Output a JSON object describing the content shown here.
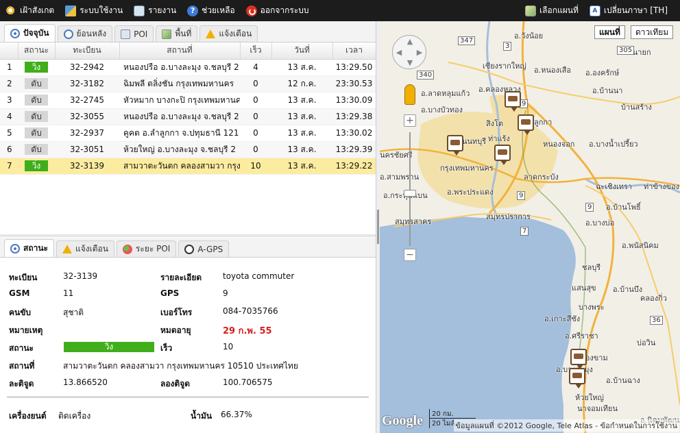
{
  "topbar": {
    "left": [
      {
        "label": "เฝ้าสังเกต",
        "icon": "search-icon"
      },
      {
        "label": "ระบบใช้งาน",
        "icon": "system-icon"
      },
      {
        "label": "รายงาน",
        "icon": "report-icon"
      },
      {
        "label": "ช่วยเหลือ",
        "icon": "help-icon"
      },
      {
        "label": "ออกจากระบบ",
        "icon": "power-icon"
      }
    ],
    "right": [
      {
        "label": "เลือกแผนที่",
        "icon": "map-icon"
      },
      {
        "label": "เปลี่ยนภาษา [TH]",
        "icon": "language-icon"
      }
    ]
  },
  "tabs_top": [
    {
      "label": "ปัจจุบัน",
      "icon": "radar-icon",
      "active": true
    },
    {
      "label": "ย้อนหลัง",
      "icon": "clock-icon"
    },
    {
      "label": "POI",
      "icon": "poi-icon"
    },
    {
      "label": "พื้นที่",
      "icon": "area-icon"
    },
    {
      "label": "แจ้งเตือน",
      "icon": "warning-icon"
    }
  ],
  "table": {
    "headers": [
      "",
      "สถานะ",
      "ทะเบียน",
      "สถานที่",
      "เร็ว",
      "วันที่",
      "เวลา"
    ],
    "rows": [
      {
        "no": "1",
        "status": "วิ่ง",
        "status_color": "#3fae1a",
        "plate": "32-2942",
        "place": "หนองปรือ อ.บางละมุง จ.ชลบุรี 2",
        "speed": "4",
        "date": "13 ส.ค.",
        "time": "13:29.50"
      },
      {
        "no": "2",
        "status": "ดับ",
        "status_color": "#d6d6d6",
        "plate": "32-3182",
        "place": "ฉิมพลี ตลิ่งชัน กรุงเทพมหานคร",
        "speed": "0",
        "date": "12 ก.ค.",
        "time": "23:30.53"
      },
      {
        "no": "3",
        "status": "ดับ",
        "status_color": "#d6d6d6",
        "plate": "32-2745",
        "place": "หัวหมาก บางกะปิ กรุงเทพมหานค",
        "speed": "0",
        "date": "13 ส.ค.",
        "time": "13:30.09"
      },
      {
        "no": "4",
        "status": "ดับ",
        "status_color": "#d6d6d6",
        "plate": "32-3055",
        "place": "หนองปรือ อ.บางละมุง จ.ชลบุรี 2",
        "speed": "0",
        "date": "13 ส.ค.",
        "time": "13:29.38"
      },
      {
        "no": "5",
        "status": "ดับ",
        "status_color": "#d6d6d6",
        "plate": "32-2937",
        "place": "คูคต อ.ลำลูกกา จ.ปทุมธานี 121",
        "speed": "0",
        "date": "13 ส.ค.",
        "time": "13:30.02"
      },
      {
        "no": "6",
        "status": "ดับ",
        "status_color": "#d6d6d6",
        "plate": "32-3051",
        "place": "ห้วยใหญ่ อ.บางละมุง จ.ชลบุรี 2",
        "speed": "0",
        "date": "13 ส.ค.",
        "time": "13:29.39"
      },
      {
        "no": "7",
        "status": "วิ่ง",
        "status_color": "#3fae1a",
        "plate": "32-3139",
        "place": "สามวาตะวันตก คลองสามวา กรุง",
        "speed": "10",
        "date": "13 ส.ค.",
        "time": "13:29.22",
        "selected": true
      }
    ]
  },
  "tabs_bottom": [
    {
      "label": "สถานะ",
      "icon": "status-icon",
      "active": true
    },
    {
      "label": "แจ้งเตือน",
      "icon": "warning-icon"
    },
    {
      "label": "ระยะ POI",
      "icon": "poi-distance-icon"
    },
    {
      "label": "A-GPS",
      "icon": "agps-icon"
    }
  ],
  "detail": {
    "plate_label": "ทะเบียน",
    "plate": "32-3139",
    "desc_label": "รายละเอียด",
    "desc": "toyota commuter",
    "gsm_label": "GSM",
    "gsm": "11",
    "gps_label": "GPS",
    "gps": "9",
    "driver_label": "คนขับ",
    "driver": "สุชาติ",
    "phone_label": "เบอร์โทร",
    "phone": "084-7035766",
    "note_label": "หมายเหตุ",
    "note": "",
    "expire_label": "หมดอายุ",
    "expire": "29 ก.พ. 55",
    "status_label": "สถานะ",
    "status": "วิ่ง",
    "speed_label": "เร็ว",
    "speed": "10",
    "place_label": "สถานที่",
    "place": "สามวาตะวันตก คลองสามวา กรุงเทพมหานคร 10510 ประเทศไทย",
    "lat_label": "ละติจูด",
    "lat": "13.866520",
    "lng_label": "ลองติจูด",
    "lng": "100.706575",
    "engine_label": "เครื่องยนต์",
    "engine": "ติดเครื่อง",
    "fuel_label": "น้ำมัน",
    "fuel": "66.37%"
  },
  "map": {
    "type_map": "แผนที่",
    "type_satellite": "ดาวเทียม",
    "labels": [
      {
        "t": "อ.วังน้อย"
      },
      {
        "t": "เชียงรากใหญ่"
      },
      {
        "t": "อ.หนองเสือ"
      },
      {
        "t": "อ.องครักษ์"
      },
      {
        "t": "อ.ลาดหลุมแก้ว"
      },
      {
        "t": "อ.คลองหลวง"
      },
      {
        "t": "อ.บ้านนา"
      },
      {
        "t": "อ.บางบัวทอง"
      },
      {
        "t": "บ้านสร้าง"
      },
      {
        "t": "สิงโต"
      },
      {
        "t": "อ.ลำลูกกา"
      },
      {
        "t": "ท่าแร้ง"
      },
      {
        "t": "หนองจอก"
      },
      {
        "t": "อ.บางน้ำเปรี้ยว"
      },
      {
        "t": "นนทบุรี"
      },
      {
        "t": "นครชัยศรี"
      },
      {
        "t": "อ.สามพราน"
      },
      {
        "t": "กรุงเทพมหานคร"
      },
      {
        "t": "ลาดกระบัง"
      },
      {
        "t": "ฉะเชิงเทรา"
      },
      {
        "t": "ท่าข้างของ"
      },
      {
        "t": "อ.กระทุ่มแบน"
      },
      {
        "t": "อ.พระประแดง"
      },
      {
        "t": "อ.บ้านโพธิ์"
      },
      {
        "t": "สมุทรสาคร"
      },
      {
        "t": "สมุทรปราการ"
      },
      {
        "t": "อ.บางบ่อ"
      },
      {
        "t": "อ.พนัสนิคม"
      },
      {
        "t": "ชลบุรี"
      },
      {
        "t": "อ.บ้านบึง"
      },
      {
        "t": "แสนสุข"
      },
      {
        "t": "คลองกิ่ว"
      },
      {
        "t": "บางพระ"
      },
      {
        "t": "อ.เกาะสีชัง"
      },
      {
        "t": "อ.ศรีราชา"
      },
      {
        "t": "หนองขาม"
      },
      {
        "t": "บ่อวิน"
      },
      {
        "t": "อ.บางละมุง"
      },
      {
        "t": "ห้วยใหญ่"
      },
      {
        "t": "นาจอมเทียน"
      },
      {
        "t": "อ.นิคมพัฒนา"
      },
      {
        "t": "อ.บ้านฉาง"
      },
      {
        "t": "นครนายก"
      }
    ],
    "road_numbers": [
      "347",
      "305",
      "340",
      "3",
      "9",
      "9",
      "9",
      "7",
      "36"
    ],
    "google": "Google",
    "scale_km": "20 กม.",
    "scale_mi": "20 ไมล์",
    "copyright": "ข้อมูลแผนที่ ©2012 Google, Tele Atlas - ข้อกำหนดในการใช้งาน"
  }
}
